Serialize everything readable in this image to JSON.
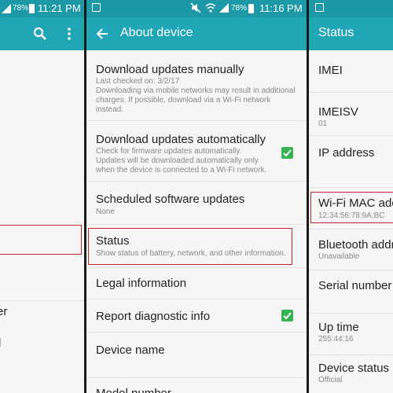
{
  "left_panel": {
    "battery": "78%",
    "time": "11:21 PM",
    "list_items": [
      "er",
      "l"
    ]
  },
  "middle_panel": {
    "battery": "78%",
    "time": "11:16 PM",
    "title": "About device",
    "items": [
      {
        "title": "Download updates manually",
        "subtitle": "Last checked on: 3/2/17\nDownloading via mobile networks may result in additional charges. If possible, download via a Wi-Fi network instead."
      },
      {
        "title": "Download updates automatically",
        "subtitle": "Check for firmware updates automatically. Updates will be downloaded automatically only when the device is connected to a Wi-Fi network."
      },
      {
        "title": "Scheduled software updates",
        "subtitle": "None"
      },
      {
        "title": "Status",
        "subtitle": "Show status of battery, network, and other information."
      },
      {
        "title": "Legal information"
      },
      {
        "title": "Report diagnostic info"
      },
      {
        "title": "Device name"
      },
      {
        "title": "Model number"
      }
    ]
  },
  "right_panel": {
    "title": "Status",
    "items": [
      {
        "title": "IMEI",
        "value": ""
      },
      {
        "title": "IMEISV",
        "value": "01"
      },
      {
        "title": "IP address",
        "value": ""
      },
      {
        "title": "Wi-Fi MAC address",
        "value": "12:34:56:78:9A:BC"
      },
      {
        "title": "Bluetooth address",
        "value": "Unavailable"
      },
      {
        "title": "Serial number",
        "value": ""
      },
      {
        "title": "Up time",
        "value": "255:44:16"
      },
      {
        "title": "Device status",
        "value": "Official"
      }
    ]
  },
  "colors": {
    "statusbar": "#1d98a7",
    "appbar": "#21a6b6",
    "highlight": "#c9242f",
    "check": "#35b353"
  }
}
